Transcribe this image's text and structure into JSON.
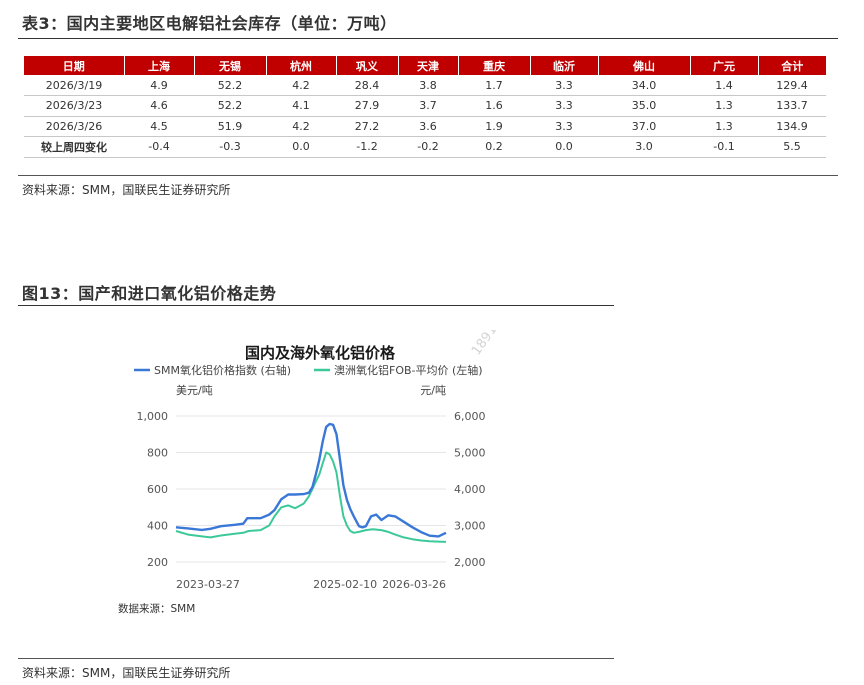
{
  "table_section": {
    "title": "表3：国内主要地区电解铝社会库存（单位：万吨）",
    "headers": [
      "日期",
      "上海",
      "无锡",
      "杭州",
      "巩义",
      "天津",
      "重庆",
      "临沂",
      "佛山",
      "广元",
      "合计"
    ],
    "rows": [
      [
        "2026/3/19",
        "4.9",
        "52.2",
        "4.2",
        "28.4",
        "3.8",
        "1.7",
        "3.3",
        "34.0",
        "1.4",
        "129.4"
      ],
      [
        "2026/3/23",
        "4.6",
        "52.2",
        "4.1",
        "27.9",
        "3.7",
        "1.6",
        "3.3",
        "35.0",
        "1.3",
        "133.7"
      ],
      [
        "2026/3/26",
        "4.5",
        "51.9",
        "4.2",
        "27.2",
        "3.6",
        "1.9",
        "3.3",
        "37.0",
        "1.3",
        "134.9"
      ],
      [
        "较上周四变化",
        "-0.4",
        "-0.3",
        "0.0",
        "-1.2",
        "-0.2",
        "0.2",
        "0.0",
        "3.0",
        "-0.1",
        "5.5"
      ]
    ],
    "source": "资料来源：SMM，国联民生证券研究所"
  },
  "figure_section": {
    "title": "图13：国产和进口氧化铝价格走势",
    "source": "资料来源：SMM，国联民生证券研究所"
  },
  "chart_data": {
    "type": "line",
    "title": "国内及海外氧化铝价格",
    "left_axis_label": "美元/吨",
    "right_axis_label": "元/吨",
    "left_ylim": [
      200,
      1000
    ],
    "right_ylim": [
      2000,
      6000
    ],
    "left_ticks": [
      "1,000",
      "800",
      "600",
      "400",
      "200"
    ],
    "right_ticks": [
      "6,000",
      "5,000",
      "4,000",
      "3,000",
      "2,000"
    ],
    "x_tick_labels": [
      "2023-03-27",
      "2025-02-10",
      "2026-03-26"
    ],
    "grid": "horizontal",
    "legend": "top",
    "source_note": "数据来源：SMM",
    "watermark": "1891",
    "series": [
      {
        "name": "SMM氧化铝价格指数 (右轴)",
        "axis": "right",
        "color": "#3a78d8",
        "points": [
          [
            "2023-03-27",
            2950
          ],
          [
            "2023-05-15",
            2920
          ],
          [
            "2023-07-10",
            2880
          ],
          [
            "2023-08-14",
            2910
          ],
          [
            "2023-09-25",
            2980
          ],
          [
            "2023-11-20",
            3020
          ],
          [
            "2023-12-25",
            3050
          ],
          [
            "2024-01-10",
            3200
          ],
          [
            "2024-03-04",
            3200
          ],
          [
            "2024-04-08",
            3300
          ],
          [
            "2024-04-29",
            3420
          ],
          [
            "2024-05-27",
            3720
          ],
          [
            "2024-06-24",
            3850
          ],
          [
            "2024-07-22",
            3850
          ],
          [
            "2024-08-26",
            3860
          ],
          [
            "2024-09-16",
            3900
          ],
          [
            "2024-09-30",
            4050
          ],
          [
            "2024-10-14",
            4400
          ],
          [
            "2024-10-28",
            4800
          ],
          [
            "2024-11-11",
            5300
          ],
          [
            "2024-11-25",
            5700
          ],
          [
            "2024-12-09",
            5780
          ],
          [
            "2024-12-23",
            5760
          ],
          [
            "2025-01-06",
            5500
          ],
          [
            "2025-01-20",
            4800
          ],
          [
            "2025-02-03",
            4100
          ],
          [
            "2025-02-17",
            3700
          ],
          [
            "2025-03-03",
            3450
          ],
          [
            "2025-03-17",
            3250
          ],
          [
            "2025-04-07",
            2980
          ],
          [
            "2025-04-21",
            2950
          ],
          [
            "2025-05-05",
            2980
          ],
          [
            "2025-05-26",
            3250
          ],
          [
            "2025-06-16",
            3300
          ],
          [
            "2025-07-07",
            3150
          ],
          [
            "2025-08-04",
            3280
          ],
          [
            "2025-09-01",
            3250
          ],
          [
            "2025-10-06",
            3100
          ],
          [
            "2025-11-10",
            2950
          ],
          [
            "2025-12-15",
            2820
          ],
          [
            "2026-01-19",
            2720
          ],
          [
            "2026-02-23",
            2700
          ],
          [
            "2026-03-26",
            2800
          ]
        ]
      },
      {
        "name": "澳洲氧化铝FOB-平均价 (左轴)",
        "axis": "left",
        "color": "#3cc99a",
        "points": [
          [
            "2023-03-27",
            370
          ],
          [
            "2023-05-15",
            350
          ],
          [
            "2023-07-10",
            340
          ],
          [
            "2023-08-14",
            335
          ],
          [
            "2023-09-25",
            345
          ],
          [
            "2023-11-20",
            355
          ],
          [
            "2023-12-25",
            360
          ],
          [
            "2024-01-15",
            370
          ],
          [
            "2024-03-04",
            375
          ],
          [
            "2024-04-08",
            400
          ],
          [
            "2024-04-29",
            450
          ],
          [
            "2024-05-27",
            500
          ],
          [
            "2024-06-24",
            510
          ],
          [
            "2024-07-22",
            495
          ],
          [
            "2024-08-26",
            520
          ],
          [
            "2024-09-16",
            560
          ],
          [
            "2024-09-30",
            600
          ],
          [
            "2024-10-14",
            640
          ],
          [
            "2024-10-28",
            680
          ],
          [
            "2024-11-11",
            740
          ],
          [
            "2024-11-25",
            800
          ],
          [
            "2024-12-09",
            790
          ],
          [
            "2024-12-23",
            750
          ],
          [
            "2025-01-06",
            690
          ],
          [
            "2025-01-20",
            560
          ],
          [
            "2025-02-03",
            450
          ],
          [
            "2025-02-17",
            400
          ],
          [
            "2025-03-03",
            370
          ],
          [
            "2025-03-17",
            360
          ],
          [
            "2025-04-07",
            365
          ],
          [
            "2025-05-05",
            375
          ],
          [
            "2025-06-02",
            380
          ],
          [
            "2025-07-07",
            375
          ],
          [
            "2025-08-04",
            365
          ],
          [
            "2025-09-01",
            350
          ],
          [
            "2025-10-06",
            335
          ],
          [
            "2025-11-10",
            325
          ],
          [
            "2025-12-15",
            318
          ],
          [
            "2026-01-19",
            314
          ],
          [
            "2026-02-23",
            312
          ],
          [
            "2026-03-26",
            310
          ]
        ]
      }
    ]
  }
}
